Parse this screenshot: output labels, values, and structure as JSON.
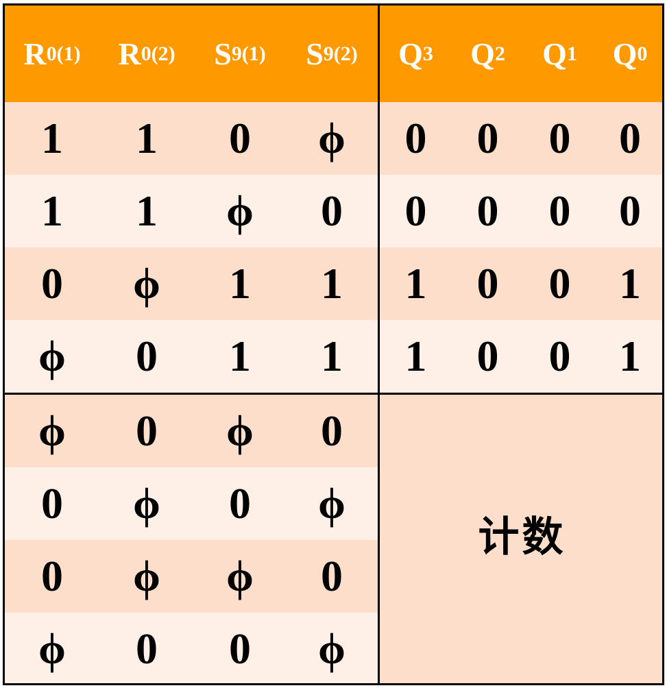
{
  "headers": {
    "inputs": [
      {
        "main": "R",
        "sub": "0(1)"
      },
      {
        "main": "R",
        "sub": "0(2)"
      },
      {
        "main": "S",
        "sub": "9(1)"
      },
      {
        "main": "S",
        "sub": "9(2)"
      }
    ],
    "outputs": [
      {
        "main": "Q",
        "sub": "3"
      },
      {
        "main": "Q",
        "sub": "2"
      },
      {
        "main": "Q",
        "sub": "1"
      },
      {
        "main": "Q",
        "sub": "0"
      }
    ]
  },
  "rows": [
    {
      "inputs": [
        "1",
        "1",
        "0",
        "ϕ"
      ],
      "outputs": [
        "0",
        "0",
        "0",
        "0"
      ]
    },
    {
      "inputs": [
        "1",
        "1",
        "ϕ",
        "0"
      ],
      "outputs": [
        "0",
        "0",
        "0",
        "0"
      ]
    },
    {
      "inputs": [
        "0",
        "ϕ",
        "1",
        "1"
      ],
      "outputs": [
        "1",
        "0",
        "0",
        "1"
      ]
    },
    {
      "inputs": [
        "ϕ",
        "0",
        "1",
        "1"
      ],
      "outputs": [
        "1",
        "0",
        "0",
        "1"
      ]
    }
  ],
  "count_rows": [
    [
      "ϕ",
      "0",
      "ϕ",
      "0"
    ],
    [
      "0",
      "ϕ",
      "0",
      "ϕ"
    ],
    [
      "0",
      "ϕ",
      "ϕ",
      "0"
    ],
    [
      "ϕ",
      "0",
      "0",
      "ϕ"
    ]
  ],
  "count_label": "计数",
  "colors": {
    "header_bg": "#ff9900",
    "header_text": "#ffffff",
    "row_odd": "#fcdecb",
    "row_even": "#feefe7",
    "border": "#000000"
  }
}
